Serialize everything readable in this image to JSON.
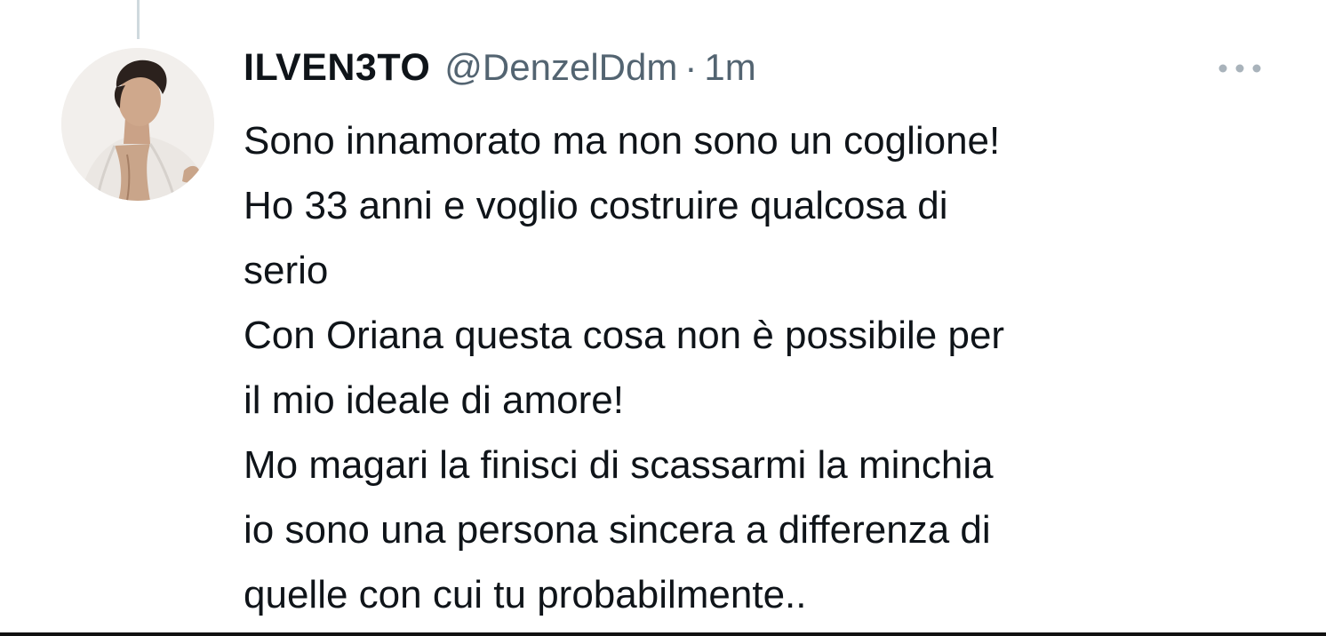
{
  "tweet": {
    "author": {
      "display_name": "ILVEN3TO",
      "handle": "@DenzelDdm",
      "avatar": "user-avatar-photo"
    },
    "separator": "·",
    "timestamp": "1m",
    "more_icon": "more-dots-icon",
    "text_lines": [
      "Sono innamorato ma non sono un coglione!",
      "Ho 33 anni e voglio costruire qualcosa di",
      "serio",
      "Con Oriana questa cosa non è possibile per",
      "il mio ideale di amore!",
      "Mo magari la finisci di scassarmi la minchia",
      "io sono una persona sincera a differenza di",
      "quelle con cui tu probabilmente.."
    ]
  },
  "colors": {
    "text_primary": "#0f1419",
    "text_secondary": "#536471",
    "thread_line": "#cfd9de",
    "background": "#ffffff"
  }
}
